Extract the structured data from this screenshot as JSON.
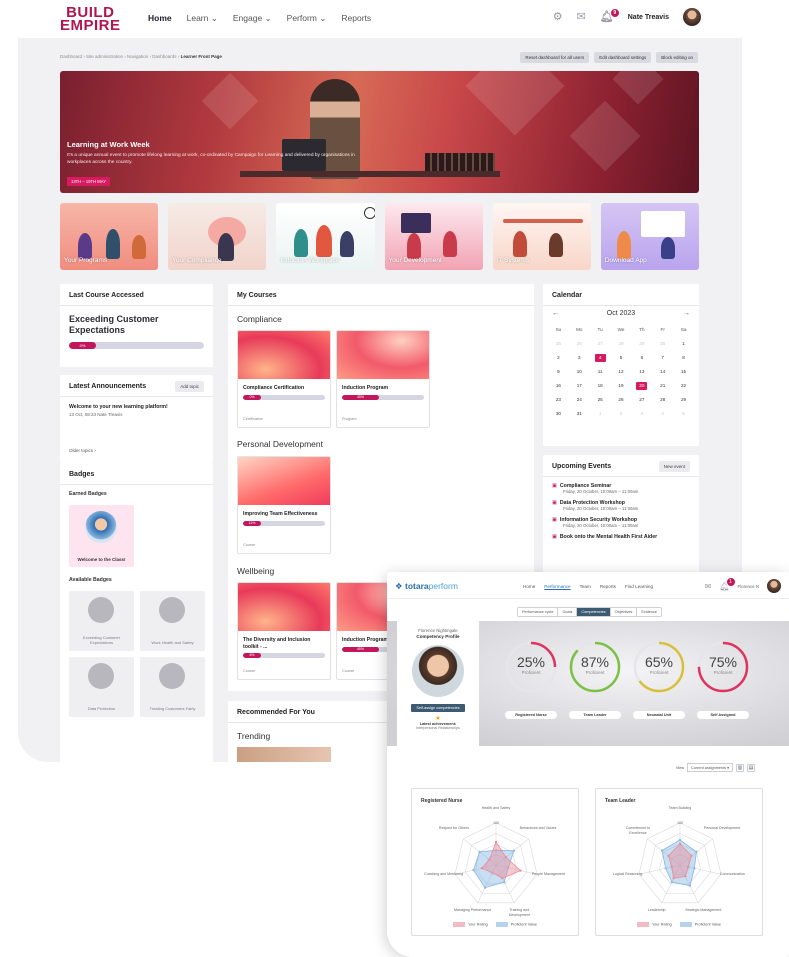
{
  "brand": {
    "line1": "BUILD",
    "line2": "EMPIRE",
    "color": "#b0154d"
  },
  "nav": {
    "links": [
      "Home",
      "Learn",
      "Engage",
      "Perform",
      "Reports"
    ],
    "active": "Home",
    "notifications": "9",
    "user": "Nate Treavis",
    "icons": [
      "gear-icon",
      "mail-icon",
      "bell-icon"
    ]
  },
  "breadcrumb": {
    "trail": "Dashboard › Site administration › Navigation › Dashboards ›",
    "current": "Learner Front Page"
  },
  "admin_buttons": [
    "Reset dashboard for all users",
    "Edit dashboard settings",
    "Block editing on"
  ],
  "hero": {
    "title": "Learning at Work Week",
    "text": "It's a unique annual event to promote lifelong learning at work, co-ordinated by Campaign for Learning and delivered by organisations in workplaces across the country.",
    "tag": "13TH – 19TH MAY"
  },
  "tiles": [
    "Your Programs",
    "Your Compliance",
    "Induction Workplace",
    "Your Development",
    "IT Systems",
    "Download App"
  ],
  "last_course": {
    "heading": "Last Course Accessed",
    "title": "Exceeding Customer Expectations",
    "progress": 0,
    "progress_label": "0%"
  },
  "announcements": {
    "heading": "Latest Announcements",
    "add_button": "Add topic",
    "item_title": "Welcome to your new learning platform!",
    "item_meta": "13 Oct, 08:23  Nate Treavis",
    "older": "Older topics ›"
  },
  "badges": {
    "heading": "Badges",
    "earned_heading": "Earned Badges",
    "earned": [
      "Welcome to the Class!"
    ],
    "available_heading": "Available Badges",
    "available": [
      "Exceeding Customer Expectations",
      "Work Health and Safety",
      "Data Protection",
      "Treating Customers Fairly"
    ]
  },
  "my_courses": {
    "heading": "My Courses",
    "sections": [
      {
        "name": "Compliance",
        "courses": [
          {
            "name": "Compliance Certification",
            "progress": 0,
            "label": "0%",
            "type": "Certification"
          },
          {
            "name": "Induction Program",
            "progress": 45,
            "label": "45%",
            "type": "Program"
          }
        ]
      },
      {
        "name": "Personal Development",
        "courses": [
          {
            "name": "Improving Team Effectiveness",
            "progress": 11,
            "label": "11%",
            "type": "Course"
          }
        ]
      },
      {
        "name": "Wellbeing",
        "courses": [
          {
            "name": "The Diversity and Inclusion toolkit - ...",
            "progress": 6,
            "label": "6%",
            "type": "Course"
          },
          {
            "name": "Induction Program",
            "progress": 45,
            "label": "45%",
            "type": "Course"
          }
        ]
      }
    ]
  },
  "recommended": {
    "heading": "Recommended For You",
    "sub": "Trending"
  },
  "calendar": {
    "heading": "Calendar",
    "month": "Oct 2023",
    "dow": [
      "Su",
      "Mo",
      "Tu",
      "We",
      "Th",
      "Fr",
      "Sa"
    ],
    "days": [
      "25",
      "26",
      "27",
      "28",
      "29",
      "30",
      "1",
      "2",
      "3",
      "4",
      "5",
      "6",
      "7",
      "8",
      "9",
      "10",
      "11",
      "12",
      "13",
      "14",
      "15",
      "16",
      "17",
      "18",
      "19",
      "20",
      "21",
      "22",
      "23",
      "24",
      "25",
      "26",
      "27",
      "28",
      "29",
      "30",
      "31",
      "1",
      "2",
      "3",
      "4",
      "5"
    ],
    "highlight": [
      "4",
      "20"
    ],
    "accent": "#d81b60"
  },
  "events": {
    "heading": "Upcoming Events",
    "new_button": "New event",
    "items": [
      {
        "name": "Compliance Seminar",
        "date": "Friday, 20 October, 10:00am – 11:00am"
      },
      {
        "name": "Data Protection Workshop",
        "date": "Friday, 20 October, 10:00am – 11:00am"
      },
      {
        "name": "Information Security Workshop",
        "date": "Friday, 20 October, 10:00am – 11:00am"
      },
      {
        "name": "Book onto the Mental Health First Aider",
        "date": ""
      }
    ]
  },
  "totara": {
    "logo_a": "totara",
    "logo_b": "perform",
    "links": [
      "Home",
      "Performance",
      "Team",
      "Reports",
      "Find Learning"
    ],
    "active": "Performance",
    "user": "Florence N",
    "notifications": "1",
    "tabs": [
      "Performance cycle",
      "Goals",
      "Competencies",
      "Objectives",
      "Evidence"
    ],
    "active_tab": "Competencies",
    "profile": {
      "name": "Florence Nightingale",
      "title": "Competency Profile",
      "button": "Self-assign competencies",
      "latest_label": "Latest achievement:",
      "latest": "Interpersonal Relationships"
    },
    "gauges": [
      {
        "value": 25,
        "label": "25%",
        "caption": "Proficient",
        "name": "Registered Nurse"
      },
      {
        "value": 87,
        "label": "87%",
        "caption": "Proficient",
        "name": "Team Leader"
      },
      {
        "value": 65,
        "label": "65%",
        "caption": "Proficient",
        "name": "Neonatal Unit"
      },
      {
        "value": 75,
        "label": "75%",
        "caption": "Proficient",
        "name": "Self Assigned"
      }
    ],
    "view_label": "View",
    "view_select": "Current assignments ▾",
    "radar": [
      {
        "title": "Registered Nurse",
        "axes": [
          "Health and Safety",
          "Behaviours and Values",
          "People Management",
          "Training and Development",
          "Managing Performance",
          "Coaching and Mentoring",
          "Respect for Others"
        ],
        "top_value": "100",
        "your": [
          0.55,
          0.3,
          0.6,
          0.35,
          0.2,
          0.35,
          0.2
        ],
        "proficient": [
          0.35,
          0.55,
          0.3,
          0.45,
          0.6,
          0.55,
          0.5
        ]
      },
      {
        "title": "Team Leader",
        "axes": [
          "Team Building",
          "Personal Development",
          "Communication",
          "Strategic Management",
          "Leadership",
          "Logical Reasoning",
          "Commitment to Excellence"
        ],
        "top_value": "100",
        "your": [
          0.5,
          0.35,
          0.2,
          0.3,
          0.35,
          0.2,
          0.35
        ],
        "proficient": [
          0.6,
          0.5,
          0.35,
          0.55,
          0.45,
          0.35,
          0.55
        ]
      }
    ],
    "legend": [
      "Your Rating",
      "Proficient Value"
    ],
    "colors": {
      "your": "#e98c99",
      "proficient": "#86b6e2"
    }
  }
}
